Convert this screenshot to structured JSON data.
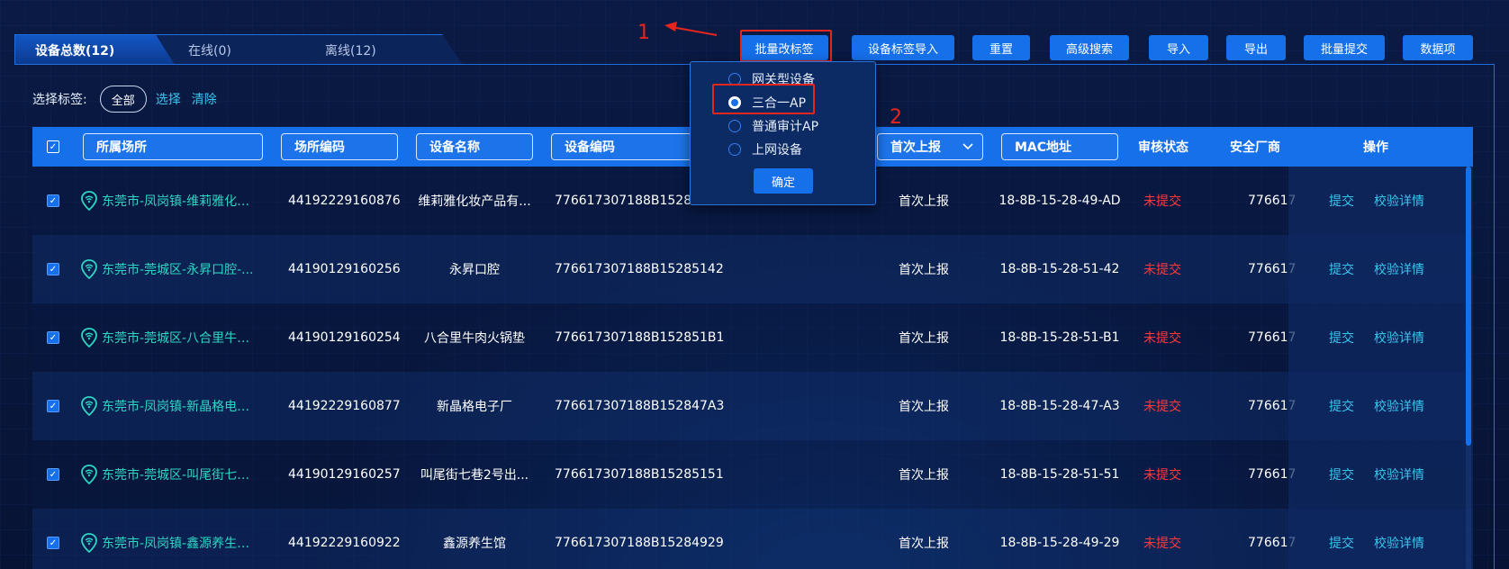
{
  "tabs": [
    {
      "label": "设备总数(12)"
    },
    {
      "label": "在线(0)"
    },
    {
      "label": "离线(12)"
    }
  ],
  "toolbar": {
    "buttons": [
      {
        "label": "批量改标签"
      },
      {
        "label": "设备标签导入"
      },
      {
        "label": "重置"
      },
      {
        "label": "高级搜索"
      },
      {
        "label": "导入"
      },
      {
        "label": "导出"
      },
      {
        "label": "批量提交"
      },
      {
        "label": "数据项"
      }
    ]
  },
  "annotations": {
    "step1": "1",
    "step2": "2"
  },
  "tag_filter": {
    "label": "选择标签:",
    "all": "全部",
    "select": "选择",
    "clear": "清除"
  },
  "dropdown": {
    "options": [
      {
        "label": "网关型设备",
        "selected": false
      },
      {
        "label": "三合一AP",
        "selected": true
      },
      {
        "label": "普通审计AP",
        "selected": false
      },
      {
        "label": "上网设备",
        "selected": false
      }
    ],
    "confirm": "确定"
  },
  "table": {
    "headers": {
      "venue": "所属场所",
      "venue_code": "场所编码",
      "device_name": "设备名称",
      "device_code": "设备编码",
      "first_report": "首次上报",
      "mac": "MAC地址",
      "review_status": "审核状态",
      "vendor": "安全厂商",
      "ops": "操作"
    },
    "rows": [
      {
        "venue": "东莞市-凤岗镇-维莉雅化妆...",
        "venue_code": "44192229160876",
        "device_name": "维莉雅化妆产品有...",
        "device_code": "776617307188B152849",
        "first_report": "首次上报",
        "mac": "18-8B-15-28-49-AD",
        "status": "未提交",
        "vendor": "776617",
        "submit": "提交",
        "detail": "校验详情"
      },
      {
        "venue": "东莞市-莞城区-永昇口腔-...",
        "venue_code": "44190129160256",
        "device_name": "永昇口腔",
        "device_code": "776617307188B15285142",
        "first_report": "首次上报",
        "mac": "18-8B-15-28-51-42",
        "status": "未提交",
        "vendor": "776617",
        "submit": "提交",
        "detail": "校验详情"
      },
      {
        "venue": "东莞市-莞城区-八合里牛肉...",
        "venue_code": "44190129160254",
        "device_name": "八合里牛肉火锅垫",
        "device_code": "776617307188B152851B1",
        "first_report": "首次上报",
        "mac": "18-8B-15-28-51-B1",
        "status": "未提交",
        "vendor": "776617",
        "submit": "提交",
        "detail": "校验详情"
      },
      {
        "venue": "东莞市-凤岗镇-新晶格电子...",
        "venue_code": "44192229160877",
        "device_name": "新晶格电子厂",
        "device_code": "776617307188B152847A3",
        "first_report": "首次上报",
        "mac": "18-8B-15-28-47-A3",
        "status": "未提交",
        "vendor": "776617",
        "submit": "提交",
        "detail": "校验详情"
      },
      {
        "venue": "东莞市-莞城区-叫尾街七巷...",
        "venue_code": "44190129160257",
        "device_name": "叫尾街七巷2号出...",
        "device_code": "776617307188B15285151",
        "first_report": "首次上报",
        "mac": "18-8B-15-28-51-51",
        "status": "未提交",
        "vendor": "776617",
        "submit": "提交",
        "detail": "校验详情"
      },
      {
        "venue": "东莞市-凤岗镇-鑫源养生馆...",
        "venue_code": "44192229160922",
        "device_name": "鑫源养生馆",
        "device_code": "776617307188B15284929",
        "first_report": "首次上报",
        "mac": "18-8B-15-28-49-29",
        "status": "未提交",
        "vendor": "776617",
        "submit": "提交",
        "detail": "校验详情"
      }
    ]
  },
  "colors": {
    "background": "#081537",
    "accent": "#1670ea",
    "link": "#38c6ee",
    "venue_text": "#2ed6c4",
    "status_red": "#ff3a3a",
    "annotation_red": "#e5261f"
  }
}
